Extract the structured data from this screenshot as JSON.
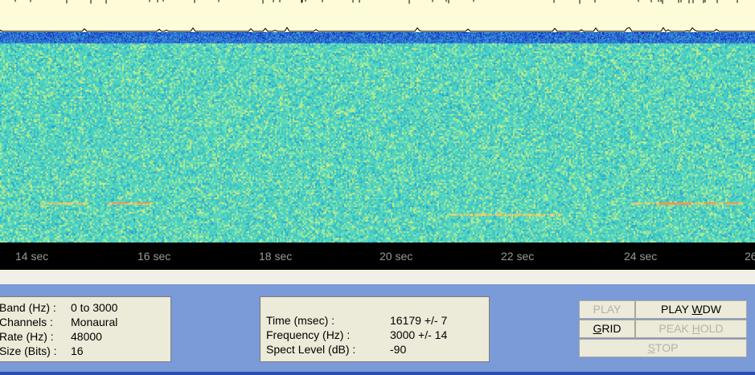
{
  "time_axis": {
    "ticks": [
      "14  sec",
      "16  sec",
      "18  sec",
      "20  sec",
      "22  sec",
      "24  sec",
      "26"
    ]
  },
  "info_panel": {
    "rows": [
      {
        "label": "Band (Hz) :",
        "value": "0 to 3000"
      },
      {
        "label": "Channels :",
        "value": "Monaural"
      },
      {
        "label": "Rate (Hz) :",
        "value": "48000"
      },
      {
        "label": "Size (Bits) :",
        "value": "16"
      }
    ]
  },
  "cursor_panel": {
    "rows": [
      {
        "label": "Time (msec) :",
        "value": "16179 +/- 7"
      },
      {
        "label": "Frequency (Hz) :",
        "value": "3000 +/- 14"
      },
      {
        "label": "Spect Level (dB) :",
        "value": "-90"
      }
    ]
  },
  "buttons": {
    "play": {
      "label": "PLAY",
      "enabled": false
    },
    "play_wdw": {
      "pre": "PLAY ",
      "ul": "W",
      "post": "DW",
      "enabled": true
    },
    "grid": {
      "pre": "",
      "ul": "G",
      "post": "RID",
      "enabled": true
    },
    "peak_hold": {
      "pre": "PEAK ",
      "ul": "H",
      "post": "OLD",
      "enabled": false
    },
    "stop": {
      "pre": "",
      "ul": "S",
      "post": "TOP",
      "enabled": false
    }
  },
  "colors": {
    "spectrogram_base": "#4fd2c2",
    "spectrogram_top_band": "#1b4fc8",
    "waveform_bg": "#fefbd8",
    "panel_bg": "#7b9ad8",
    "box_bg": "#ecead8"
  }
}
